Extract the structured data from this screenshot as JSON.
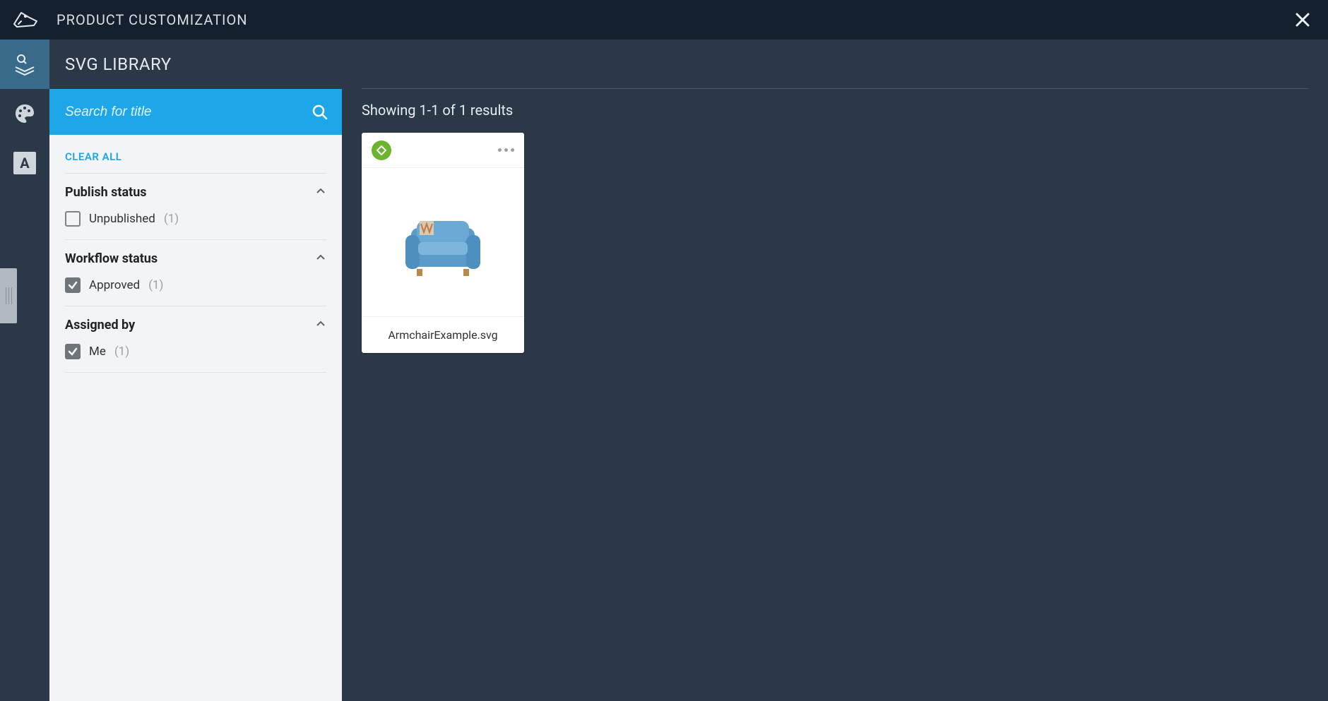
{
  "header": {
    "title": "PRODUCT CUSTOMIZATION"
  },
  "panel": {
    "title": "SVG LIBRARY",
    "search_placeholder": "Search for title",
    "clear_all": "CLEAR ALL"
  },
  "filters": {
    "groups": [
      {
        "title": "Publish status",
        "option_label": "Unpublished",
        "option_count": "(1)",
        "checked": false
      },
      {
        "title": "Workflow status",
        "option_label": "Approved",
        "option_count": "(1)",
        "checked": true
      },
      {
        "title": "Assigned by",
        "option_label": "Me",
        "option_count": "(1)",
        "checked": true
      }
    ]
  },
  "results": {
    "summary": "Showing 1-1 of 1 results",
    "cards": [
      {
        "filename": "ArmchairExample.svg"
      }
    ]
  }
}
